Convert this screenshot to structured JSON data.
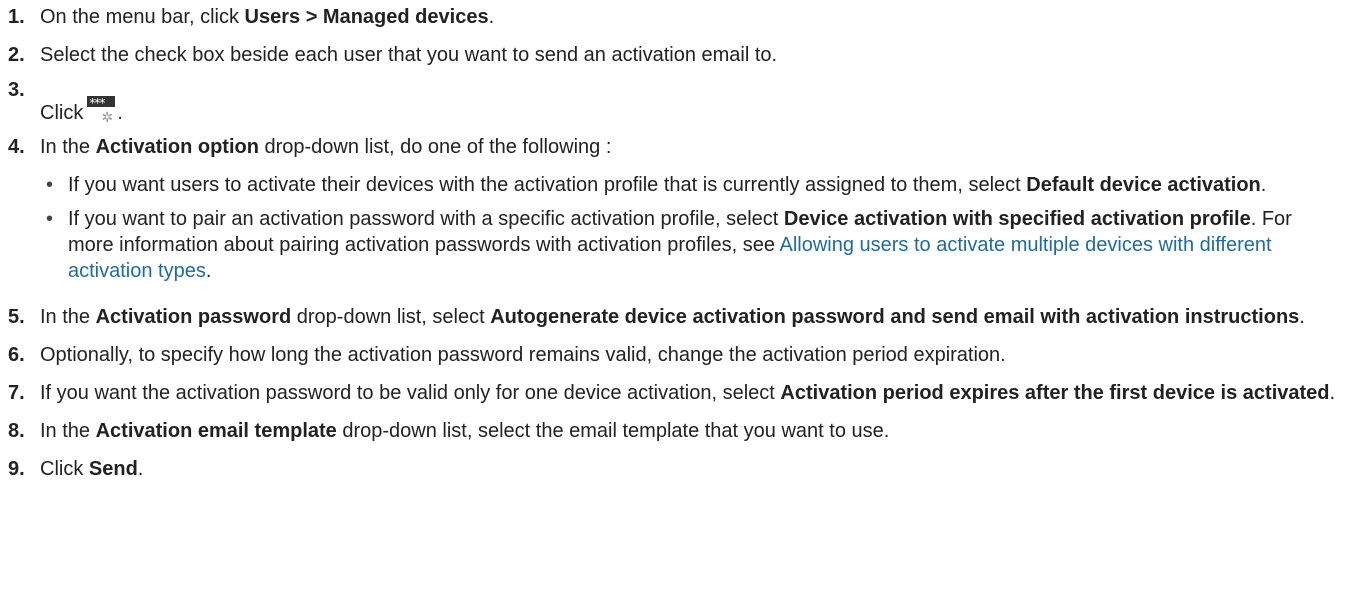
{
  "steps": [
    {
      "num": "1.",
      "a": "On the menu bar, click ",
      "b": "Users > Managed devices",
      "c": "."
    },
    {
      "num": "2.",
      "a": "Select the check box beside each user that you want to send an activation email to."
    },
    {
      "num": "3.",
      "a": "Click ",
      "c": ".",
      "icon": "send-activation-email-icon"
    },
    {
      "num": "4.",
      "a": "In the ",
      "b": "Activation option",
      "c": " drop-down list, do one of the following :",
      "bullets": [
        {
          "a": "If you want users to activate their devices with the activation profile that is currently assigned to them, select ",
          "b": "Default device activation",
          "c": "."
        },
        {
          "a": "If you want to pair an activation password with a specific activation profile, select ",
          "b": "Device activation with specified activation profile",
          "c": ". For more information about pairing activation passwords with activation profiles, see ",
          "link": "Allowing users to activate multiple devices with different activation types",
          "d": "."
        }
      ]
    },
    {
      "num": "5.",
      "a": "In the ",
      "b": "Activation password",
      "c": " drop-down list, select ",
      "d": "Autogenerate device activation password and send email with activation instructions",
      "e": "."
    },
    {
      "num": "6.",
      "a": "Optionally, to specify how long the activation password remains valid, change the activation period expiration."
    },
    {
      "num": "7.",
      "a": "If you want the activation password to be valid only for one device activation, select ",
      "b": "Activation period expires after the first device is activated",
      "c": "."
    },
    {
      "num": "8.",
      "a": "In the ",
      "b": "Activation email template",
      "c": " drop-down list, select the email template that you want to use."
    },
    {
      "num": "9.",
      "a": "Click ",
      "b": "Send",
      "c": "."
    }
  ]
}
